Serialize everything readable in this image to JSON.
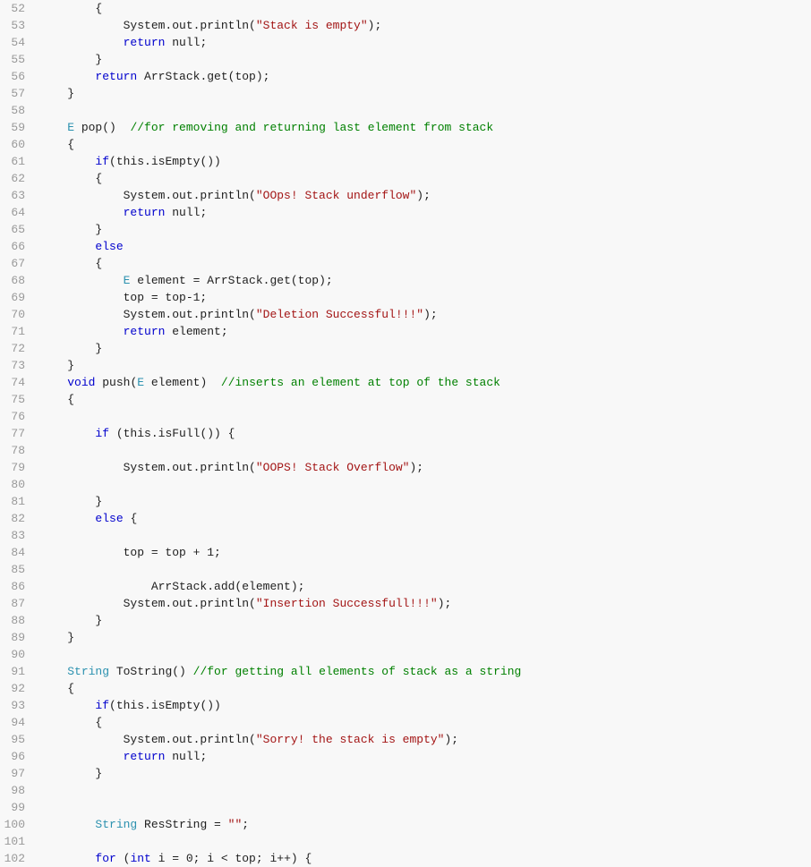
{
  "editor": {
    "background": "#f8f8f8",
    "lines": [
      {
        "num": 52,
        "tokens": [
          {
            "t": "plain",
            "v": "        {"
          }
        ]
      },
      {
        "num": 53,
        "tokens": [
          {
            "t": "plain",
            "v": "            System.out.println("
          },
          {
            "t": "string",
            "v": "\"Stack is empty\""
          },
          {
            "t": "plain",
            "v": ");"
          }
        ]
      },
      {
        "num": 54,
        "tokens": [
          {
            "t": "plain",
            "v": "            "
          },
          {
            "t": "kw",
            "v": "return"
          },
          {
            "t": "plain",
            "v": " null;"
          }
        ]
      },
      {
        "num": 55,
        "tokens": [
          {
            "t": "plain",
            "v": "        }"
          }
        ]
      },
      {
        "num": 56,
        "tokens": [
          {
            "t": "plain",
            "v": "        "
          },
          {
            "t": "kw",
            "v": "return"
          },
          {
            "t": "plain",
            "v": " ArrStack.get(top);"
          }
        ]
      },
      {
        "num": 57,
        "tokens": [
          {
            "t": "plain",
            "v": "    }"
          }
        ]
      },
      {
        "num": 58,
        "tokens": []
      },
      {
        "num": 59,
        "tokens": [
          {
            "t": "plain",
            "v": "    "
          },
          {
            "t": "type",
            "v": "E"
          },
          {
            "t": "plain",
            "v": " pop()  "
          },
          {
            "t": "comment",
            "v": "//for removing and returning last element from stack"
          }
        ]
      },
      {
        "num": 60,
        "tokens": [
          {
            "t": "plain",
            "v": "    {"
          }
        ]
      },
      {
        "num": 61,
        "tokens": [
          {
            "t": "plain",
            "v": "        "
          },
          {
            "t": "kw",
            "v": "if"
          },
          {
            "t": "plain",
            "v": "(this.isEmpty())"
          }
        ]
      },
      {
        "num": 62,
        "tokens": [
          {
            "t": "plain",
            "v": "        {"
          }
        ]
      },
      {
        "num": 63,
        "tokens": [
          {
            "t": "plain",
            "v": "            System.out.println("
          },
          {
            "t": "string",
            "v": "\"OOps! Stack underflow\""
          },
          {
            "t": "plain",
            "v": ");"
          }
        ]
      },
      {
        "num": 64,
        "tokens": [
          {
            "t": "plain",
            "v": "            "
          },
          {
            "t": "kw",
            "v": "return"
          },
          {
            "t": "plain",
            "v": " null;"
          }
        ]
      },
      {
        "num": 65,
        "tokens": [
          {
            "t": "plain",
            "v": "        }"
          }
        ]
      },
      {
        "num": 66,
        "tokens": [
          {
            "t": "plain",
            "v": "        "
          },
          {
            "t": "kw",
            "v": "else"
          }
        ]
      },
      {
        "num": 67,
        "tokens": [
          {
            "t": "plain",
            "v": "        {"
          }
        ]
      },
      {
        "num": 68,
        "tokens": [
          {
            "t": "plain",
            "v": "            "
          },
          {
            "t": "type",
            "v": "E"
          },
          {
            "t": "plain",
            "v": " element = ArrStack.get(top);"
          }
        ]
      },
      {
        "num": 69,
        "tokens": [
          {
            "t": "plain",
            "v": "            top = top-1;"
          }
        ]
      },
      {
        "num": 70,
        "tokens": [
          {
            "t": "plain",
            "v": "            System.out.println("
          },
          {
            "t": "string",
            "v": "\"Deletion Successful!!!\""
          },
          {
            "t": "plain",
            "v": ");"
          }
        ]
      },
      {
        "num": 71,
        "tokens": [
          {
            "t": "plain",
            "v": "            "
          },
          {
            "t": "kw",
            "v": "return"
          },
          {
            "t": "plain",
            "v": " element;"
          }
        ]
      },
      {
        "num": 72,
        "tokens": [
          {
            "t": "plain",
            "v": "        }"
          }
        ]
      },
      {
        "num": 73,
        "tokens": [
          {
            "t": "plain",
            "v": "    }"
          }
        ]
      },
      {
        "num": 74,
        "tokens": [
          {
            "t": "plain",
            "v": "    "
          },
          {
            "t": "kw",
            "v": "void"
          },
          {
            "t": "plain",
            "v": " push("
          },
          {
            "t": "type",
            "v": "E"
          },
          {
            "t": "plain",
            "v": " element)  "
          },
          {
            "t": "comment",
            "v": "//inserts an element at top of the stack"
          }
        ]
      },
      {
        "num": 75,
        "tokens": [
          {
            "t": "plain",
            "v": "    {"
          }
        ]
      },
      {
        "num": 76,
        "tokens": []
      },
      {
        "num": 77,
        "tokens": [
          {
            "t": "plain",
            "v": "        "
          },
          {
            "t": "kw",
            "v": "if"
          },
          {
            "t": "plain",
            "v": " (this.isFull()) {"
          }
        ]
      },
      {
        "num": 78,
        "tokens": []
      },
      {
        "num": 79,
        "tokens": [
          {
            "t": "plain",
            "v": "            System.out.println("
          },
          {
            "t": "string",
            "v": "\"OOPS! Stack Overflow\""
          },
          {
            "t": "plain",
            "v": ");"
          }
        ]
      },
      {
        "num": 80,
        "tokens": []
      },
      {
        "num": 81,
        "tokens": [
          {
            "t": "plain",
            "v": "        }"
          }
        ]
      },
      {
        "num": 82,
        "tokens": [
          {
            "t": "plain",
            "v": "        "
          },
          {
            "t": "kw",
            "v": "else"
          },
          {
            "t": "plain",
            "v": " {"
          }
        ]
      },
      {
        "num": 83,
        "tokens": []
      },
      {
        "num": 84,
        "tokens": [
          {
            "t": "plain",
            "v": "            top = top + 1;"
          }
        ]
      },
      {
        "num": 85,
        "tokens": []
      },
      {
        "num": 86,
        "tokens": [
          {
            "t": "plain",
            "v": "                ArrStack.add(element);"
          }
        ]
      },
      {
        "num": 87,
        "tokens": [
          {
            "t": "plain",
            "v": "            System.out.println("
          },
          {
            "t": "string",
            "v": "\"Insertion Successfull!!!\""
          },
          {
            "t": "plain",
            "v": ");"
          }
        ]
      },
      {
        "num": 88,
        "tokens": [
          {
            "t": "plain",
            "v": "        }"
          }
        ]
      },
      {
        "num": 89,
        "tokens": [
          {
            "t": "plain",
            "v": "    }"
          }
        ]
      },
      {
        "num": 90,
        "tokens": []
      },
      {
        "num": 91,
        "tokens": [
          {
            "t": "plain",
            "v": "    "
          },
          {
            "t": "type",
            "v": "String"
          },
          {
            "t": "plain",
            "v": " ToString() "
          },
          {
            "t": "comment",
            "v": "//for getting all elements of stack as a string"
          }
        ]
      },
      {
        "num": 92,
        "tokens": [
          {
            "t": "plain",
            "v": "    {"
          }
        ]
      },
      {
        "num": 93,
        "tokens": [
          {
            "t": "plain",
            "v": "        "
          },
          {
            "t": "kw",
            "v": "if"
          },
          {
            "t": "plain",
            "v": "(this.isEmpty())"
          }
        ]
      },
      {
        "num": 94,
        "tokens": [
          {
            "t": "plain",
            "v": "        {"
          }
        ]
      },
      {
        "num": 95,
        "tokens": [
          {
            "t": "plain",
            "v": "            System.out.println("
          },
          {
            "t": "string",
            "v": "\"Sorry! the stack is empty\""
          },
          {
            "t": "plain",
            "v": ");"
          }
        ]
      },
      {
        "num": 96,
        "tokens": [
          {
            "t": "plain",
            "v": "            "
          },
          {
            "t": "kw",
            "v": "return"
          },
          {
            "t": "plain",
            "v": " null;"
          }
        ]
      },
      {
        "num": 97,
        "tokens": [
          {
            "t": "plain",
            "v": "        }"
          }
        ]
      },
      {
        "num": 98,
        "tokens": []
      },
      {
        "num": 99,
        "tokens": []
      },
      {
        "num": 100,
        "tokens": [
          {
            "t": "plain",
            "v": "        "
          },
          {
            "t": "type",
            "v": "String"
          },
          {
            "t": "plain",
            "v": " ResString = "
          },
          {
            "t": "string",
            "v": "\"\""
          },
          {
            "t": "plain",
            "v": ";"
          }
        ]
      },
      {
        "num": 101,
        "tokens": []
      },
      {
        "num": 102,
        "tokens": [
          {
            "t": "plain",
            "v": "        "
          },
          {
            "t": "kw",
            "v": "for"
          },
          {
            "t": "plain",
            "v": " ("
          },
          {
            "t": "kw",
            "v": "int"
          },
          {
            "t": "plain",
            "v": " i = 0; i < top; i++) {"
          }
        ]
      }
    ]
  }
}
